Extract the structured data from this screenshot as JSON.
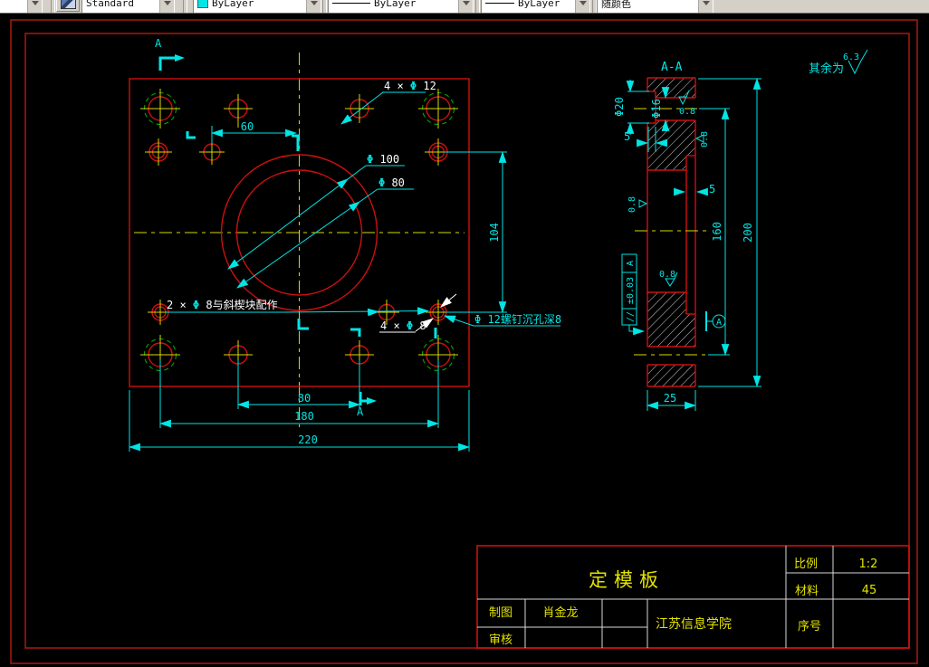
{
  "toolbar": {
    "layer_value": "",
    "style_label": "Standard",
    "color_label": "ByLayer",
    "linetype_label": "ByLayer",
    "lineweight_label": "ByLayer",
    "plotstyle_label": "随颜色",
    "swatch_color": "#00e5e5"
  },
  "colors": {
    "background": "#000000",
    "entity_red": "#cc1010",
    "frame_red": "#9e1a10",
    "centerline_yellow": "#d9d900",
    "dimension_cyan": "#00e5e5",
    "thread_green": "#00a800",
    "hatch_white": "#e8e8e8",
    "title_text_yellow": "#e3e300"
  },
  "plan": {
    "section_letter": "A",
    "dim_60": "60",
    "dim_104": "104",
    "dim_80": "80",
    "dim_180": "180",
    "dim_220": "220",
    "label_4xd12": {
      "pre": "4 × ",
      "sym": "Φ",
      "post": " 12"
    },
    "label_d100": {
      "sym": "Φ",
      "post": " 100"
    },
    "label_d80": {
      "sym": "Φ",
      "post": " 80"
    },
    "label_2xd8": {
      "pre": "2 × ",
      "sym": "Φ",
      "post": " 8与斜楔块配作"
    },
    "label_4xd8": {
      "pre": "4 × ",
      "sym": "Φ",
      "post": " 8"
    },
    "label_counterbore": "Φ 12螺钉沉孔深8"
  },
  "section": {
    "title": "A-A",
    "dim_d20": "Φ20",
    "dim_d16": "Φ16",
    "dim_5": "5",
    "dim_160": "160",
    "dim_200": "200",
    "dim_25": "25",
    "finish_08": "0.8",
    "tol_symbol": "//",
    "tol_value": "±0.03",
    "datum_letter": "A",
    "general_finish_text": "其余为",
    "general_finish_value": "6.3"
  },
  "title_block": {
    "part_name": "定模板",
    "scale_label": "比例",
    "scale_value": "1:2",
    "material_label": "材料",
    "material_value": "45",
    "drawn_label": "制图",
    "drawn_value": "肖金龙",
    "checked_label": "审核",
    "checked_value": "",
    "organization": "江苏信息学院",
    "serial_label": "序号",
    "serial_value": ""
  }
}
